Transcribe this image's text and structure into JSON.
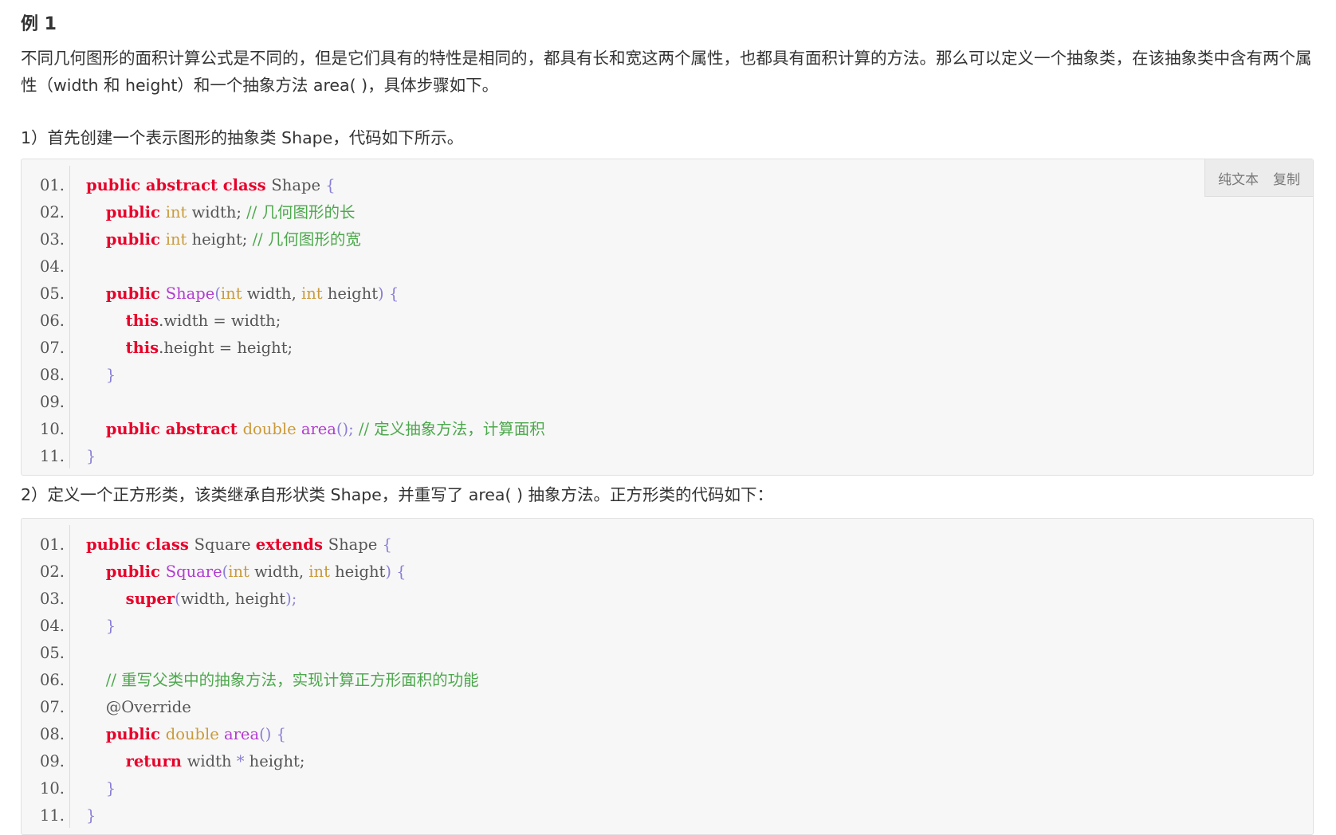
{
  "example_title": "例 1",
  "intro_text": "不同几何图形的面积计算公式是不同的，但是它们具有的特性是相同的，都具有长和宽这两个属性，也都具有面积计算的方法。那么可以定义一个抽象类，在该抽象类中含有两个属性（width 和 height）和一个抽象方法 area( )，具体步骤如下。",
  "step1_text": "1）首先创建一个表示图形的抽象类 Shape，代码如下所示。",
  "step2_text": "2）定义一个正方形类，该类继承自形状类 Shape，并重写了 area( ) 抽象方法。正方形类的代码如下：",
  "toolbar": {
    "plain_text": "纯文本",
    "copy": "复制"
  },
  "code1": [
    {
      "n": "01.",
      "t": [
        [
          "kw",
          "public abstract class "
        ],
        [
          "pl",
          "Shape "
        ],
        [
          "pn",
          "{"
        ]
      ]
    },
    {
      "n": "02.",
      "t": [
        [
          "pl",
          "    "
        ],
        [
          "kw",
          "public "
        ],
        [
          "ty",
          "int "
        ],
        [
          "pl",
          "width; "
        ],
        [
          "cm",
          "// 几何图形的长"
        ]
      ]
    },
    {
      "n": "03.",
      "t": [
        [
          "pl",
          "    "
        ],
        [
          "kw",
          "public "
        ],
        [
          "ty",
          "int "
        ],
        [
          "pl",
          "height; "
        ],
        [
          "cm",
          "// 几何图形的宽"
        ]
      ]
    },
    {
      "n": "04.",
      "t": []
    },
    {
      "n": "05.",
      "t": [
        [
          "pl",
          "    "
        ],
        [
          "kw",
          "public "
        ],
        [
          "fn",
          "Shape"
        ],
        [
          "pn",
          "("
        ],
        [
          "ty",
          "int "
        ],
        [
          "pl",
          "width, "
        ],
        [
          "ty",
          "int "
        ],
        [
          "pl",
          "height"
        ],
        [
          "pn",
          ") {"
        ]
      ]
    },
    {
      "n": "06.",
      "t": [
        [
          "pl",
          "        "
        ],
        [
          "kw",
          "this"
        ],
        [
          "pl",
          ".width = width;"
        ]
      ]
    },
    {
      "n": "07.",
      "t": [
        [
          "pl",
          "        "
        ],
        [
          "kw",
          "this"
        ],
        [
          "pl",
          ".height = height;"
        ]
      ]
    },
    {
      "n": "08.",
      "t": [
        [
          "pl",
          "    "
        ],
        [
          "pn",
          "}"
        ]
      ]
    },
    {
      "n": "09.",
      "t": []
    },
    {
      "n": "10.",
      "t": [
        [
          "pl",
          "    "
        ],
        [
          "kw",
          "public abstract "
        ],
        [
          "ty",
          "double "
        ],
        [
          "fn",
          "area"
        ],
        [
          "pn",
          "(); "
        ],
        [
          "cm",
          "// 定义抽象方法，计算面积"
        ]
      ]
    },
    {
      "n": "11.",
      "t": [
        [
          "pn",
          "}"
        ]
      ]
    }
  ],
  "code2": [
    {
      "n": "01.",
      "t": [
        [
          "kw",
          "public class "
        ],
        [
          "pl",
          "Square "
        ],
        [
          "kw",
          "extends "
        ],
        [
          "pl",
          "Shape "
        ],
        [
          "pn",
          "{"
        ]
      ]
    },
    {
      "n": "02.",
      "t": [
        [
          "pl",
          "    "
        ],
        [
          "kw",
          "public "
        ],
        [
          "fn",
          "Square"
        ],
        [
          "pn",
          "("
        ],
        [
          "ty",
          "int "
        ],
        [
          "pl",
          "width, "
        ],
        [
          "ty",
          "int "
        ],
        [
          "pl",
          "height"
        ],
        [
          "pn",
          ") {"
        ]
      ]
    },
    {
      "n": "03.",
      "t": [
        [
          "pl",
          "        "
        ],
        [
          "kw",
          "super"
        ],
        [
          "pn",
          "("
        ],
        [
          "pl",
          "width, height"
        ],
        [
          "pn",
          ");"
        ]
      ]
    },
    {
      "n": "04.",
      "t": [
        [
          "pl",
          "    "
        ],
        [
          "pn",
          "}"
        ]
      ]
    },
    {
      "n": "05.",
      "t": []
    },
    {
      "n": "06.",
      "t": [
        [
          "pl",
          "    "
        ],
        [
          "cm",
          "// 重写父类中的抽象方法，实现计算正方形面积的功能"
        ]
      ]
    },
    {
      "n": "07.",
      "t": [
        [
          "pl",
          "    @Override"
        ]
      ]
    },
    {
      "n": "08.",
      "t": [
        [
          "pl",
          "    "
        ],
        [
          "kw",
          "public "
        ],
        [
          "ty",
          "double "
        ],
        [
          "fn",
          "area"
        ],
        [
          "pn",
          "() {"
        ]
      ]
    },
    {
      "n": "09.",
      "t": [
        [
          "pl",
          "        "
        ],
        [
          "kw",
          "return "
        ],
        [
          "pl",
          "width "
        ],
        [
          "pn",
          "*"
        ],
        [
          "pl",
          " height;"
        ]
      ]
    },
    {
      "n": "10.",
      "t": [
        [
          "pl",
          "    "
        ],
        [
          "pn",
          "}"
        ]
      ]
    },
    {
      "n": "11.",
      "t": [
        [
          "pn",
          "}"
        ]
      ]
    }
  ]
}
